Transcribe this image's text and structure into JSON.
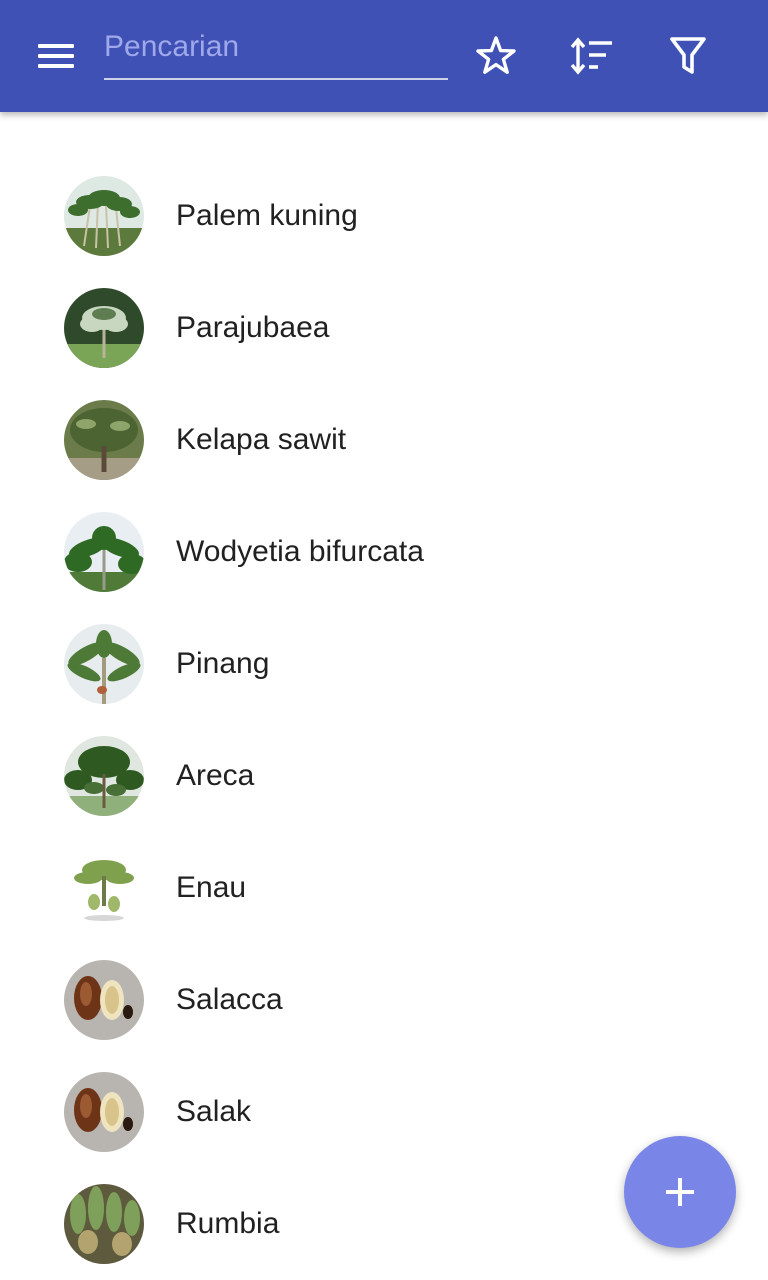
{
  "header": {
    "search_placeholder": "Pencarian",
    "background_color": "#3f51b5",
    "icons": [
      "menu-icon",
      "star-outline-icon",
      "sort-icon",
      "filter-icon"
    ]
  },
  "list": {
    "items": [
      {
        "label": "Palem kuning",
        "thumbnail": "palm-grove-photo"
      },
      {
        "label": "Parajubaea",
        "thumbnail": "tall-palm-photo"
      },
      {
        "label": "Kelapa sawit",
        "thumbnail": "oil-palm-photo"
      },
      {
        "label": "Wodyetia bifurcata",
        "thumbnail": "foxtail-palm-photo"
      },
      {
        "label": "Pinang",
        "thumbnail": "areca-palm-photo"
      },
      {
        "label": "Areca",
        "thumbnail": "areca-garden-photo"
      },
      {
        "label": "Enau",
        "thumbnail": "sugar-palm-illustration"
      },
      {
        "label": "Salacca",
        "thumbnail": "snake-fruit-photo"
      },
      {
        "label": "Salak",
        "thumbnail": "snake-fruit-photo"
      },
      {
        "label": "Rumbia",
        "thumbnail": "sago-palm-photo"
      }
    ]
  },
  "fab": {
    "icon": "plus-icon",
    "color": "#7986e8"
  }
}
